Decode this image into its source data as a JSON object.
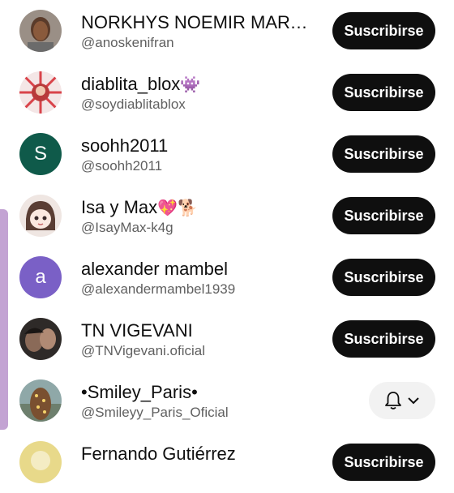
{
  "subscribe_label": "Suscribirse",
  "channels": [
    {
      "name": "NORKHYS NOEMIR MARTI...",
      "handle": "@anoskenifran",
      "avatar": "photo-woman"
    },
    {
      "name": "diablita_blox",
      "name_emoji": "👾",
      "handle": "@soydiablitablox",
      "avatar": "cartoon-avatar"
    },
    {
      "name": "soohh2011",
      "handle": "@soohh2011",
      "avatar_letter": "S",
      "avatar_color": "#0f5a4a"
    },
    {
      "name": "Isa y Max",
      "name_emoji": "💖🐕",
      "handle": "@IsayMax-k4g",
      "avatar": "anime-avatar"
    },
    {
      "name": "alexander mambel",
      "handle": "@alexandermambel1939",
      "avatar_letter": "a",
      "avatar_color": "#7a60c6"
    },
    {
      "name": "TN VIGEVANI",
      "handle": "@TNVigevani.oficial",
      "avatar": "photo-couple"
    },
    {
      "name": "•Smiley_Paris•",
      "handle": "@Smileyy_Paris_Oficial",
      "avatar": "photo-hair",
      "subscribed": true
    },
    {
      "name": "Fernando Gutiérrez",
      "handle": "",
      "avatar": "photo-partial"
    }
  ],
  "colors": {
    "button_bg": "#0f0f0f",
    "button_text": "#ffffff",
    "handle_text": "#606060",
    "scroll_indicator": "#c3a3d3"
  }
}
